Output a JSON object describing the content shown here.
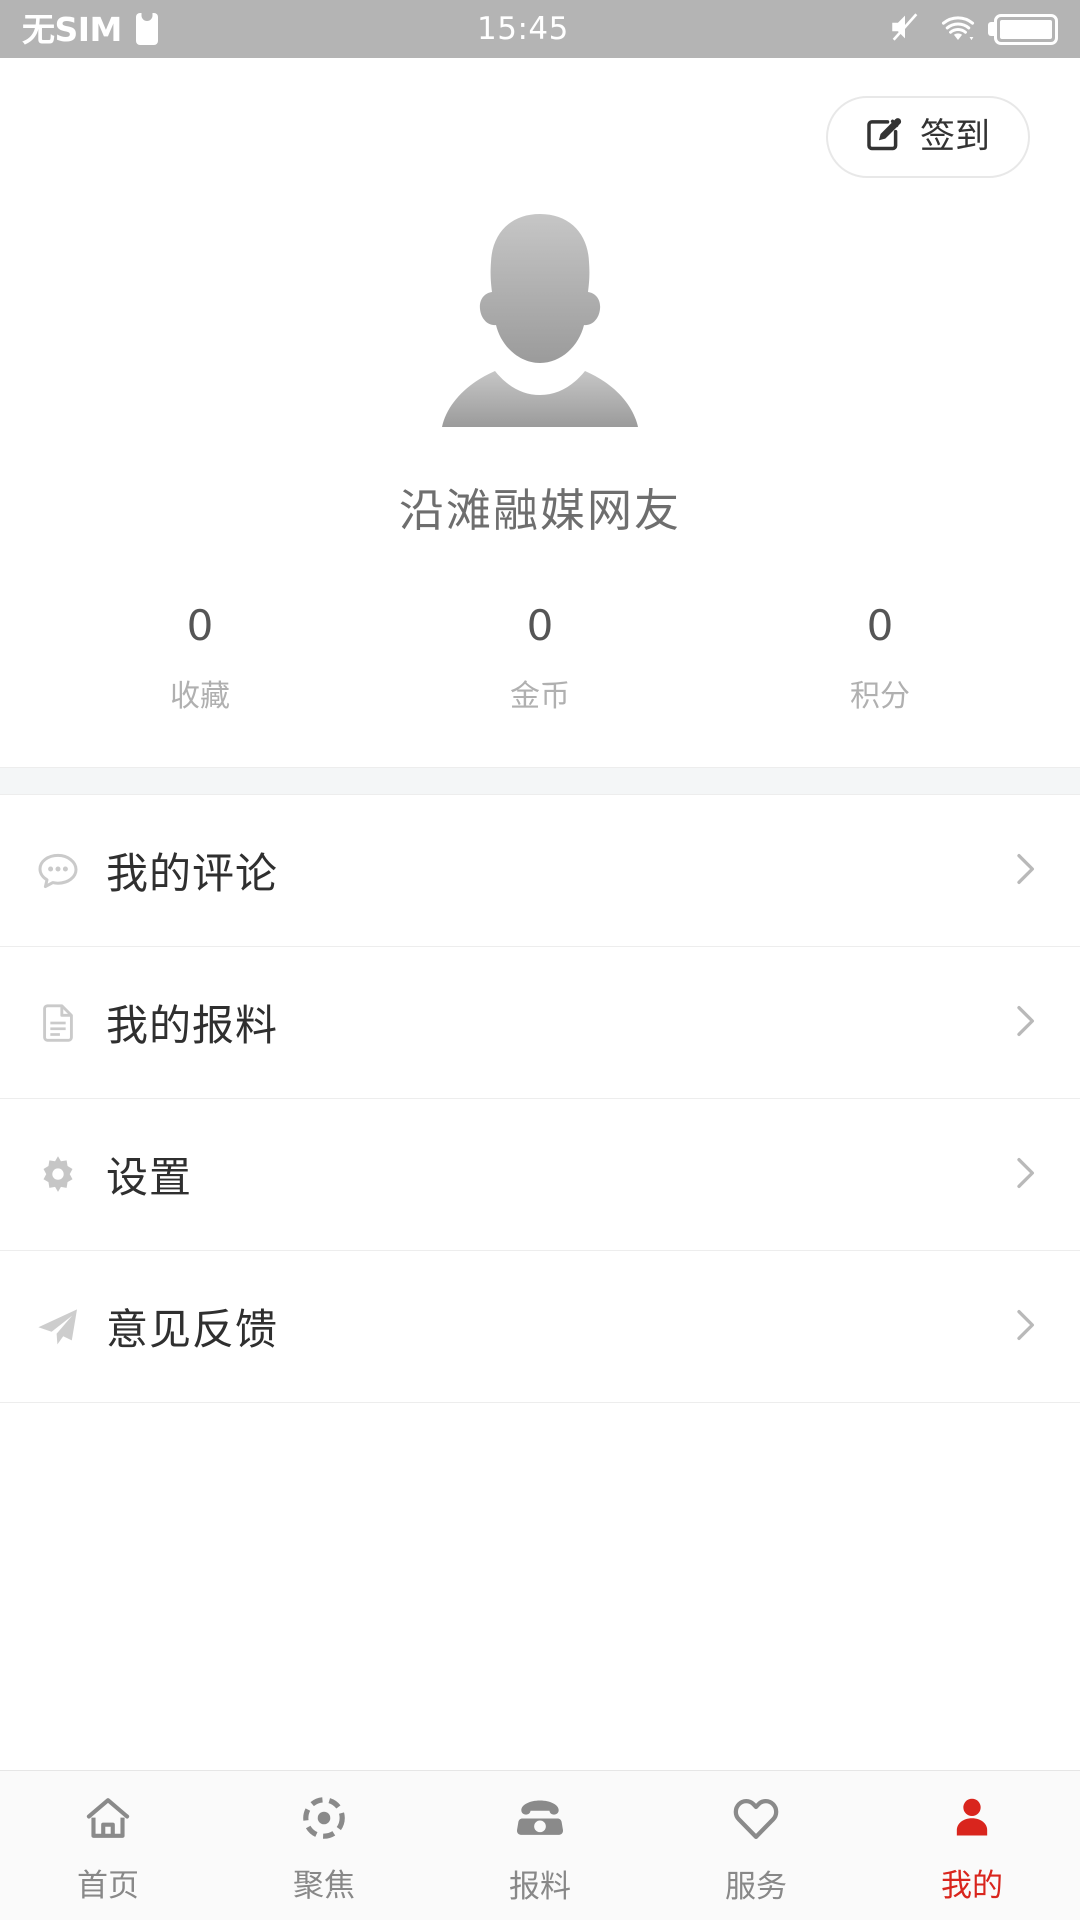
{
  "status_bar": {
    "carrier": "无SIM",
    "sim_icon": "sim-card-icon",
    "time": "15:45",
    "mute_icon": "mute-icon",
    "wifi_icon": "wifi-icon",
    "battery_icon": "battery-full-icon",
    "background_color": "#b4b4b4",
    "text_color": "#ffffff"
  },
  "profile": {
    "signin_button": {
      "label": "签到",
      "icon": "edit-pencil-icon"
    },
    "avatar_icon": "default-user-avatar",
    "username": "沿滩融媒网友",
    "stats": [
      {
        "value": "0",
        "label": "收藏",
        "name": "favorites"
      },
      {
        "value": "0",
        "label": "金币",
        "name": "coins"
      },
      {
        "value": "0",
        "label": "积分",
        "name": "points"
      }
    ]
  },
  "menu": {
    "items": [
      {
        "label": "我的评论",
        "icon": "comment-bubble-icon",
        "chevron": "chevron-right-icon"
      },
      {
        "label": "我的报料",
        "icon": "document-icon",
        "chevron": "chevron-right-icon"
      },
      {
        "label": "设置",
        "icon": "gear-icon",
        "chevron": "chevron-right-icon"
      },
      {
        "label": "意见反馈",
        "icon": "paper-plane-icon",
        "chevron": "chevron-right-icon"
      }
    ]
  },
  "tab_bar": {
    "active_color": "#d9251d",
    "inactive_color": "#888888",
    "tabs": [
      {
        "label": "首页",
        "icon": "home-icon",
        "active": false
      },
      {
        "label": "聚焦",
        "icon": "focus-target-icon",
        "active": false
      },
      {
        "label": "报料",
        "icon": "telephone-icon",
        "active": false
      },
      {
        "label": "服务",
        "icon": "heart-icon",
        "active": false
      },
      {
        "label": "我的",
        "icon": "person-icon",
        "active": true
      }
    ]
  }
}
